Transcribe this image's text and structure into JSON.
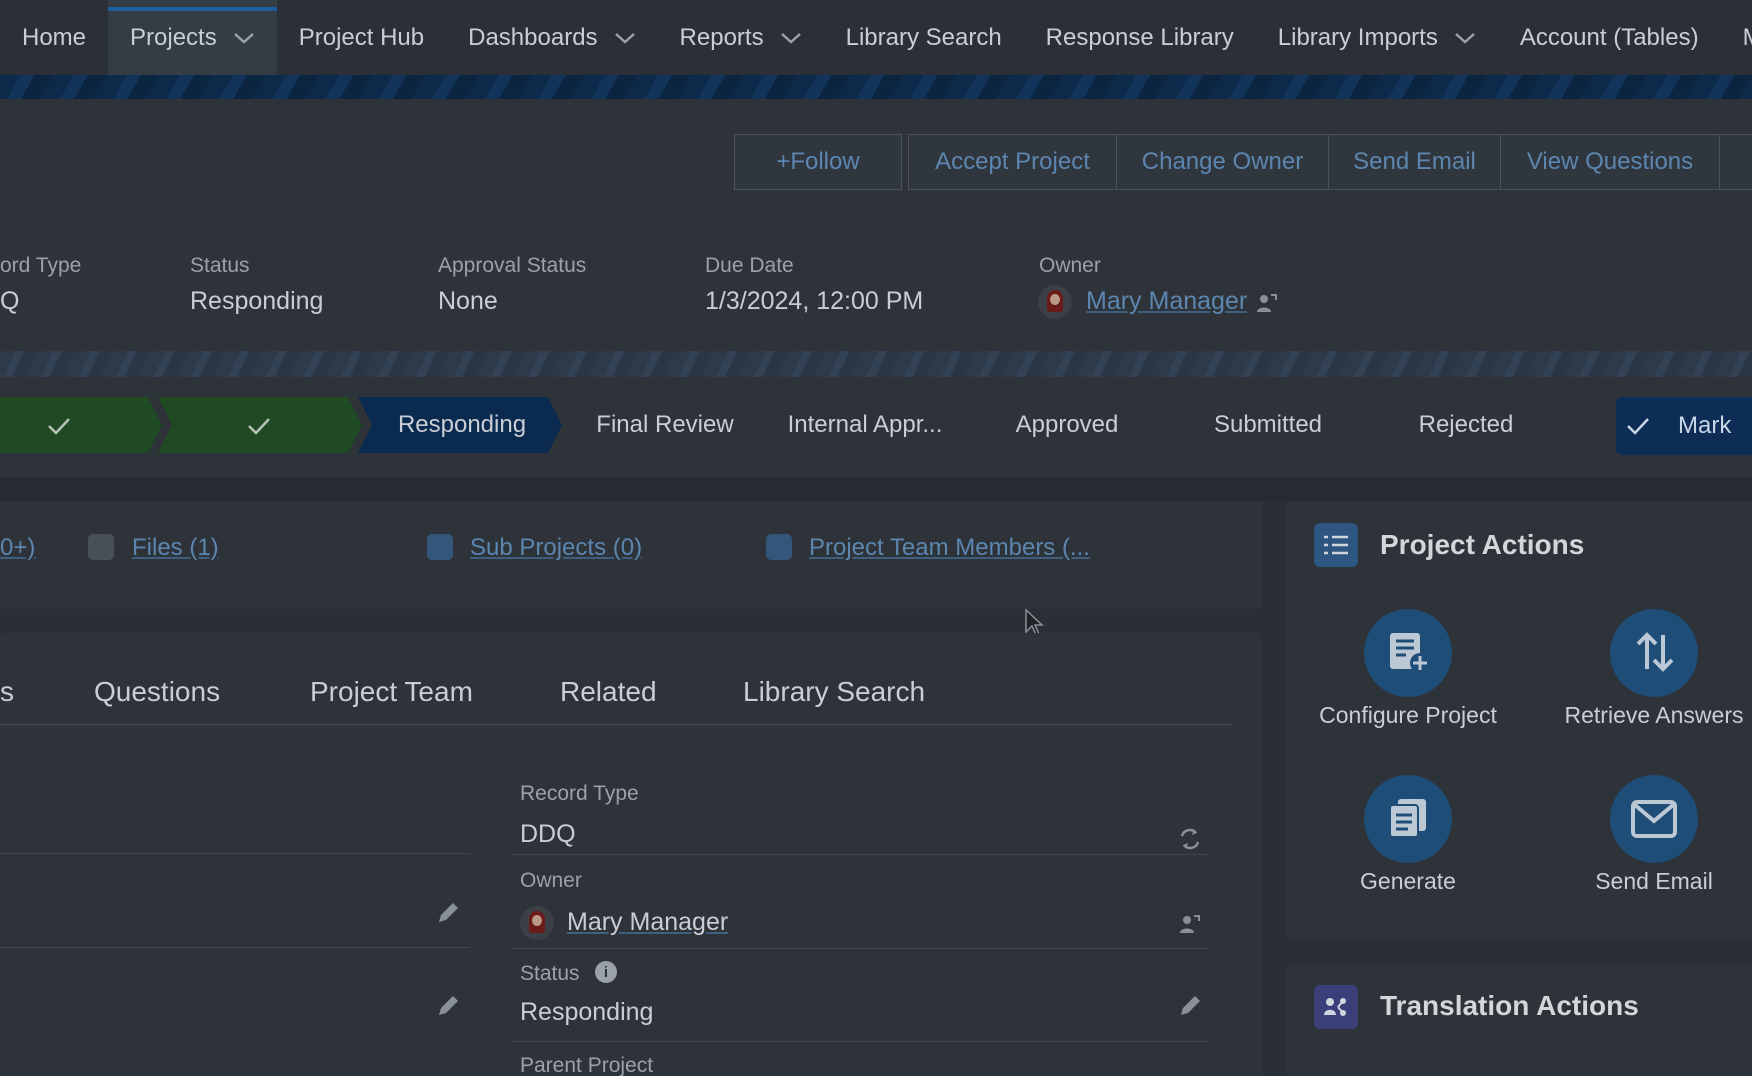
{
  "nav": {
    "items": [
      {
        "label": "Home",
        "has_menu": false
      },
      {
        "label": "Projects",
        "has_menu": true,
        "active": true
      },
      {
        "label": "Project Hub",
        "has_menu": false
      },
      {
        "label": "Dashboards",
        "has_menu": true
      },
      {
        "label": "Reports",
        "has_menu": true
      },
      {
        "label": "Library Search",
        "has_menu": false
      },
      {
        "label": "Response Library",
        "has_menu": false
      },
      {
        "label": "Library Imports",
        "has_menu": true
      },
      {
        "label": "Account (Tables)",
        "has_menu": false
      },
      {
        "label": "Mo",
        "has_menu": false
      }
    ]
  },
  "actions": {
    "follow": "Follow",
    "accept_project": "Accept Project",
    "change_owner": "Change Owner",
    "send_email": "Send Email",
    "view_questions": "View Questions"
  },
  "highlights": {
    "record_type_label": "ord Type",
    "record_type_value": "Q",
    "status_label": "Status",
    "status_value": "Responding",
    "approval_label": "Approval Status",
    "approval_value": "None",
    "due_label": "Due Date",
    "due_value": "1/3/2024, 12:00 PM",
    "owner_label": "Owner",
    "owner_value": "Mary Manager"
  },
  "path": {
    "stages": [
      "Responding",
      "Final Review",
      "Internal Appr...",
      "Approved",
      "Submitted",
      "Rejected"
    ],
    "mark_button": "Mark"
  },
  "related": {
    "partial": "0+)",
    "files": "Files (1)",
    "sub_projects": "Sub Projects (0)",
    "team_members": "Project Team Members (..."
  },
  "tabs": {
    "partial": "s",
    "questions": "Questions",
    "project_team": "Project Team",
    "related": "Related",
    "library_search": "Library Search"
  },
  "details": {
    "record_type_label": "Record Type",
    "record_type_value": "DDQ",
    "owner_label": "Owner",
    "owner_value": "Mary Manager",
    "status_label": "Status",
    "status_value": "Responding",
    "parent_label": "Parent Project"
  },
  "project_actions": {
    "title": "Project Actions",
    "configure": "Configure Project",
    "retrieve": "Retrieve Answers",
    "generate": "Generate",
    "send_email": "Send Email"
  },
  "translation_actions": {
    "title": "Translation Actions"
  }
}
